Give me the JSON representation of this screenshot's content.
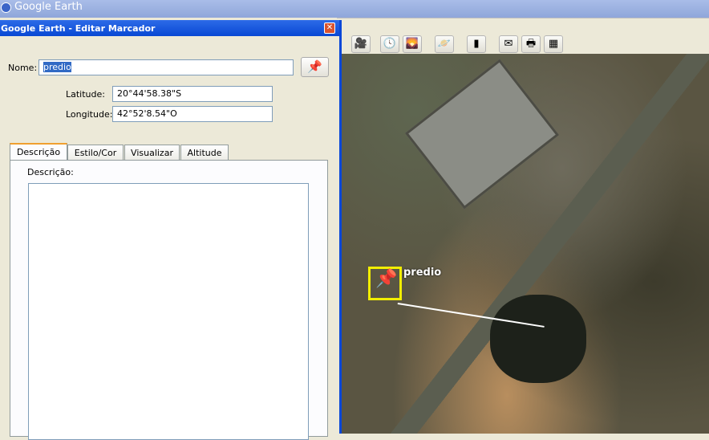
{
  "app": {
    "title": "Google Earth"
  },
  "toolbar": {
    "buttons": [
      "movie-icon",
      "clock-icon",
      "sunlight-icon",
      "planet-icon",
      "ruler-icon",
      "email-icon",
      "print-icon",
      "map-image-icon"
    ]
  },
  "dialog": {
    "title": "Google Earth - Editar Marcador",
    "close": "✕",
    "name_label": "Nome:",
    "name_value": "predio",
    "lat_label": "Latitude:",
    "lat_value": "20°44'58.38\"S",
    "lon_label": "Longitude:",
    "lon_value": "42°52'8.54\"O",
    "tabs": [
      "Descrição",
      "Estilo/Cor",
      "Visualizar",
      "Altitude"
    ],
    "desc_label": "Descrição:",
    "desc_value": ""
  },
  "map": {
    "placemark_label": "predio"
  },
  "colors": {
    "title_blue": "#0848d4",
    "pin_yellow": "#f2ee00"
  }
}
